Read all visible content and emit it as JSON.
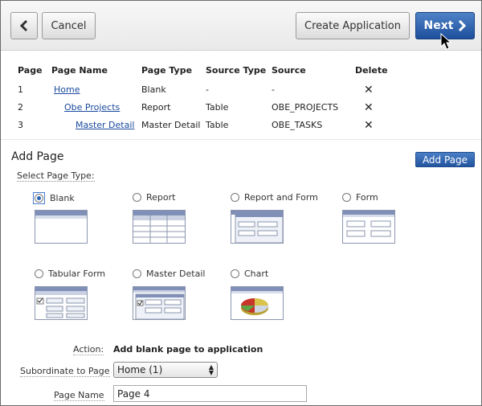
{
  "toolbar": {
    "cancel_label": "Cancel",
    "create_label": "Create Application",
    "next_label": "Next"
  },
  "pages_table": {
    "headers": {
      "page": "Page",
      "page_name": "Page Name",
      "page_type": "Page Type",
      "source_type": "Source Type",
      "source": "Source",
      "delete": "Delete"
    },
    "rows": [
      {
        "page": "1",
        "page_name": "Home",
        "page_type": "Blank",
        "source_type": "-",
        "source": "-",
        "delete": "✕"
      },
      {
        "page": "2",
        "page_name": "Obe Projects",
        "page_type": "Report",
        "source_type": "Table",
        "source": "OBE_PROJECTS",
        "delete": "✕"
      },
      {
        "page": "3",
        "page_name": "Master Detail",
        "page_type": "Master Detail",
        "source_type": "Table",
        "source": "OBE_TASKS",
        "delete": "✕"
      }
    ]
  },
  "add_page": {
    "heading": "Add Page",
    "button_label": "Add Page",
    "select_type_label": "Select Page Type:",
    "selected_type": "Blank",
    "types": [
      {
        "label": "Blank",
        "icon": "blank-page-icon"
      },
      {
        "label": "Report",
        "icon": "report-page-icon"
      },
      {
        "label": "Report and Form",
        "icon": "report-and-form-page-icon"
      },
      {
        "label": "Form",
        "icon": "form-page-icon"
      },
      {
        "label": "Tabular Form",
        "icon": "tabular-form-page-icon"
      },
      {
        "label": "Master Detail",
        "icon": "master-detail-page-icon"
      },
      {
        "label": "Chart",
        "icon": "chart-page-icon"
      }
    ],
    "action_label": "Action:",
    "action_value": "Add blank page to application",
    "subordinate_label": "Subordinate to Page",
    "subordinate_value": "Home (1)",
    "page_name_label": "Page Name",
    "page_name_value": "Page 4"
  },
  "colors": {
    "accent": "#1d4f9c",
    "link": "#1a4a9c",
    "thumb_header": "#7f8fb8"
  }
}
